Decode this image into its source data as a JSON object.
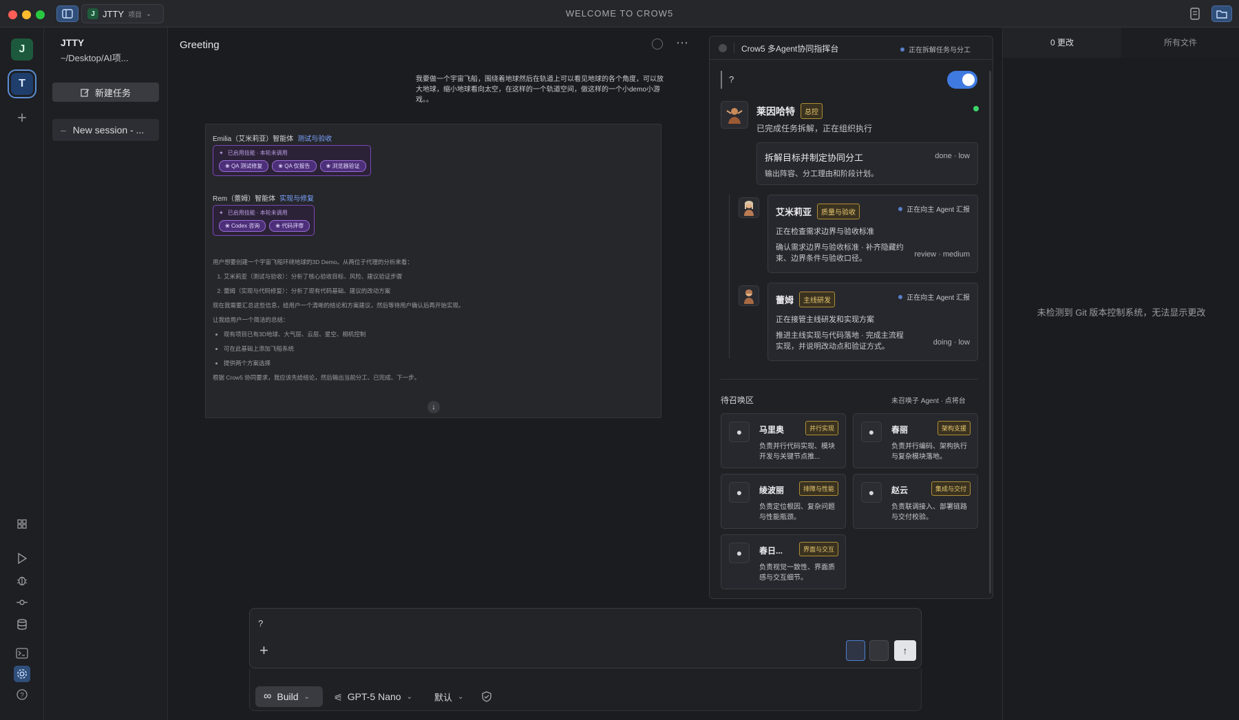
{
  "titlebar": {
    "window_title": "WELCOME TO CROW5",
    "project_badge": "J",
    "project_name": "JTTY",
    "project_sub": "项目"
  },
  "rail": {
    "workspaces": [
      "J",
      "T"
    ],
    "add": "+"
  },
  "sessions": {
    "project_name": "JTTY",
    "project_path": "~/Desktop/AI项...",
    "new_task_label": "新建任务",
    "items": [
      {
        "label": "New session - ..."
      }
    ]
  },
  "chat": {
    "title": "Greeting",
    "user_message": "我要做一个宇宙飞船，围绕着地球然后在轨道上可以看见地球的各个角度，可以放大地球，缩小地球看向太空，在这样的一个轨道空间，做这样的一个小demo小游戏。。",
    "agents": [
      {
        "name": "Emilia（艾米莉亚）智能体",
        "role": "测试与验收",
        "skill_head": "已启用技能 · 本轮未调用",
        "skills": [
          "QA 测试修复",
          "QA 仅报告",
          "浏览器验证"
        ]
      },
      {
        "name": "Rem（蕾姆）智能体",
        "role": "实现与修复",
        "skill_head": "已启用技能 · 本轮未调用",
        "skills": [
          "Codex 咨询",
          "代码评审"
        ]
      }
    ],
    "reasoning": {
      "intro": "用户想要创建一个宇宙飞船环绕地球的3D Demo。从两位子代理的分析来看：",
      "ordered": [
        "艾米莉亚（测试与验收）：分析了核心验收目标、风险、建议验证步骤",
        "蕾姆（实现与代码修复）：分析了现有代码基础、建议的改动方案"
      ],
      "p2": "现在我需要汇总这些信息，给用户一个清晰的结论和方案建议，然后等待用户确认后再开始实现。",
      "p3": "让我给用户一个简洁的总结：",
      "bullets": [
        "现有项目已有3D地球、大气层、云层、星空、相机控制",
        "可在此基础上添加飞船系统",
        "提供两个方案选择"
      ],
      "p4": "根据 Crow5 协同要求，我应该先给结论，然后输出当前分工、已完成、下一步。"
    }
  },
  "composer": {
    "text": "?",
    "mode": "Build",
    "model": "GPT-5 Nano",
    "variant": "默认"
  },
  "agent_panel": {
    "title": "Crow5 多Agent协同指挥台",
    "state": "正在拆解任务与分工",
    "question": "?",
    "lead": {
      "name": "莱因哈特",
      "badge": "总控",
      "status": "已完成任务拆解，正在组织执行",
      "task_title": "拆解目标并制定协同分工",
      "task_meta": "done · low",
      "task_desc": "输出阵容、分工理由和阶段计划。"
    },
    "subagents": [
      {
        "name": "艾米莉亚",
        "badge": "质量与验收",
        "state": "正在向主 Agent 汇报",
        "line": "正在检查需求边界与验收标准",
        "desc": "确认需求边界与验收标准 · 补齐隐藏约束、边界条件与验收口径。",
        "meta": "review · medium"
      },
      {
        "name": "蕾姆",
        "badge": "主线研发",
        "state": "正在向主 Agent 汇报",
        "line": "正在接管主线研发和实现方案",
        "desc": "推进主线实现与代码落地 · 完成主流程实现，并说明改动点和验证方式。",
        "meta": "doing · low"
      }
    ],
    "standby_title": "待召唤区",
    "standby_note": "未召唤子 Agent · 点将台",
    "standby": [
      {
        "name": "马里奥",
        "badge": "并行实现",
        "desc": "负责并行代码实现、模块开发与关键节点推..."
      },
      {
        "name": "春丽",
        "badge": "架构支援",
        "desc": "负责并行编码、架构执行与复杂模块落地。"
      },
      {
        "name": "绫波丽",
        "badge": "排障与性能",
        "desc": "负责定位根因、复杂问题与性能瓶颈。"
      },
      {
        "name": "赵云",
        "badge": "集成与交付",
        "desc": "负责联调接入、部署链路与交付校验。"
      },
      {
        "name": "春日...",
        "badge": "界面与交互",
        "desc": "负责视觉一致性、界面质感与交互细节。"
      }
    ]
  },
  "git": {
    "tab_changes": "0 更改",
    "tab_files": "所有文件",
    "empty": "未检测到 Git 版本控制系统，无法显示更改"
  },
  "colors": {
    "accent_blue": "#3f7ae0",
    "skill_purple": "#7a48b8",
    "badge_gold": "#e8c86e",
    "online_green": "#3bd46a"
  }
}
